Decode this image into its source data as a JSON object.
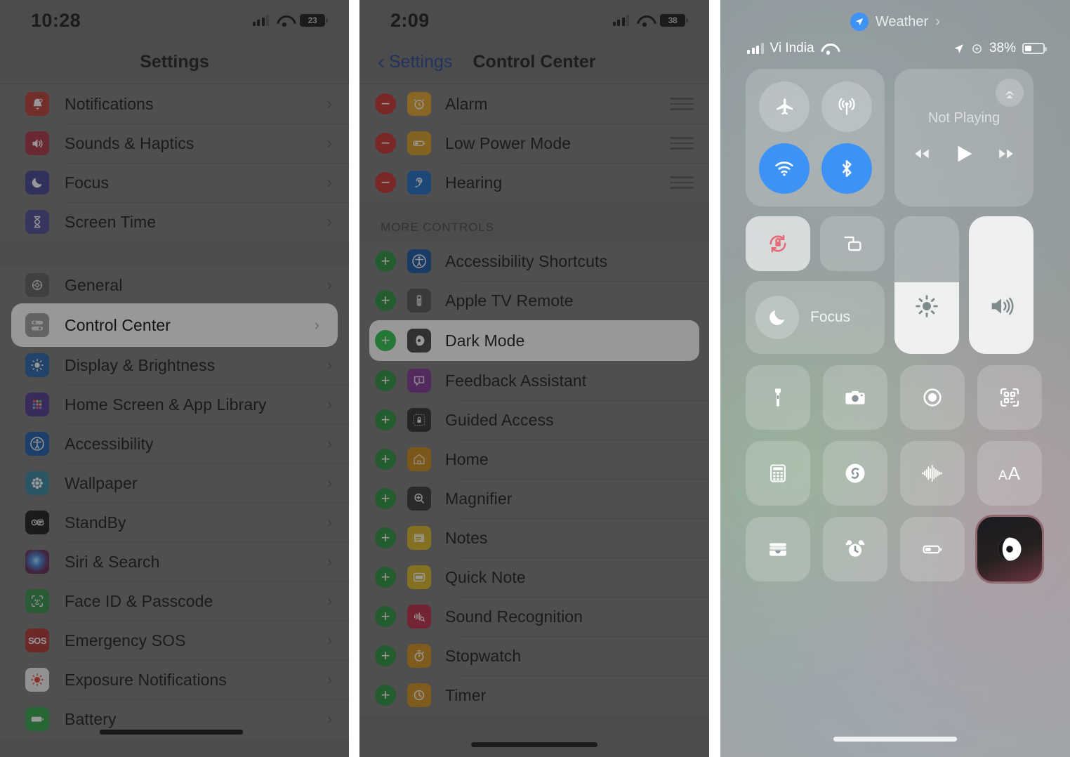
{
  "panel1": {
    "status": {
      "time": "10:28",
      "battery": "23"
    },
    "nav_title": "Settings",
    "groups": [
      {
        "items": [
          {
            "label": "Notifications",
            "icon": "bell-icon",
            "color": "#b7352c"
          },
          {
            "label": "Sounds & Haptics",
            "icon": "speaker-icon",
            "color": "#a82a3c"
          },
          {
            "label": "Focus",
            "icon": "moon-icon",
            "color": "#3b3a8f"
          },
          {
            "label": "Screen Time",
            "icon": "hourglass-icon",
            "color": "#434393"
          }
        ]
      },
      {
        "items": [
          {
            "label": "General",
            "icon": "gear-icon",
            "color": "#575757"
          },
          {
            "label": "Control Center",
            "icon": "sliders-icon",
            "color": "#6e6e6e",
            "highlighted": true
          },
          {
            "label": "Display & Brightness",
            "icon": "brightness-icon",
            "color": "#1f5fa8"
          },
          {
            "label": "Home Screen & App Library",
            "icon": "apps-grid-icon",
            "color": "#4a2f8a"
          },
          {
            "label": "Accessibility",
            "icon": "accessibility-icon",
            "color": "#1257a5"
          },
          {
            "label": "Wallpaper",
            "icon": "flower-icon",
            "color": "#2d7f9e"
          },
          {
            "label": "StandBy",
            "icon": "standby-icon",
            "color": "#101010"
          },
          {
            "label": "Siri & Search",
            "icon": "siri-icon",
            "color": "#2b1e3d"
          },
          {
            "label": "Face ID & Passcode",
            "icon": "face-id-icon",
            "color": "#2a8a43"
          },
          {
            "label": "Emergency SOS",
            "icon": "sos-icon",
            "color": "#ab2b27"
          },
          {
            "label": "Exposure Notifications",
            "icon": "exposure-icon",
            "color": "#f0f0f0"
          },
          {
            "label": "Battery",
            "icon": "battery-icon",
            "color": "#29a042"
          }
        ]
      }
    ]
  },
  "panel2": {
    "status": {
      "time": "2:09",
      "battery": "38"
    },
    "nav_back": "Settings",
    "nav_title": "Control Center",
    "included": [
      {
        "label": "Alarm",
        "icon": "alarm-clock-icon",
        "color": "#e2a020",
        "action": "remove"
      },
      {
        "label": "Low Power Mode",
        "icon": "low-battery-icon",
        "color": "#d79a18",
        "action": "remove"
      },
      {
        "label": "Hearing",
        "icon": "ear-icon",
        "color": "#1565c0",
        "action": "remove"
      }
    ],
    "more_controls_header": "MORE CONTROLS",
    "more_controls": [
      {
        "label": "Accessibility Shortcuts",
        "icon": "accessibility-icon",
        "color": "#0b4f9e",
        "action": "add"
      },
      {
        "label": "Apple TV Remote",
        "icon": "remote-icon",
        "color": "#4c4c4c",
        "action": "add"
      },
      {
        "label": "Dark Mode",
        "icon": "dark-mode-icon",
        "color": "#3a3a3a",
        "action": "add",
        "highlighted": true
      },
      {
        "label": "Feedback Assistant",
        "icon": "feedback-icon",
        "color": "#7b2d8e",
        "action": "add"
      },
      {
        "label": "Guided Access",
        "icon": "lock-frame-icon",
        "color": "#232323",
        "action": "add"
      },
      {
        "label": "Home",
        "icon": "house-icon",
        "color": "#c8820f",
        "action": "add"
      },
      {
        "label": "Magnifier",
        "icon": "magnifier-icon",
        "color": "#2c2c2c",
        "action": "add"
      },
      {
        "label": "Notes",
        "icon": "notes-icon",
        "color": "#d6b31a",
        "action": "add"
      },
      {
        "label": "Quick Note",
        "icon": "quick-note-icon",
        "color": "#d6b31a",
        "action": "add"
      },
      {
        "label": "Sound Recognition",
        "icon": "sound-wave-icon",
        "color": "#b8203c",
        "action": "add"
      },
      {
        "label": "Stopwatch",
        "icon": "stopwatch-icon",
        "color": "#d08a16",
        "action": "add"
      },
      {
        "label": "Timer",
        "icon": "timer-icon",
        "color": "#d08a16",
        "action": "add"
      }
    ]
  },
  "panel3": {
    "weather_label": "Weather",
    "carrier": "Vi India",
    "battery_pct": "38%",
    "media": {
      "title": "Not Playing"
    },
    "focus_label": "Focus",
    "connectivity": [
      {
        "name": "airplane-mode-icon",
        "on": false
      },
      {
        "name": "cellular-data-icon",
        "on": false
      },
      {
        "name": "wifi-icon",
        "on": true
      },
      {
        "name": "bluetooth-icon",
        "on": true
      }
    ],
    "tiles_row3": [
      "flashlight-icon",
      "camera-icon",
      "screen-record-icon",
      "qr-scanner-icon"
    ],
    "tiles_row4": [
      "calculator-icon",
      "shazam-icon",
      "sound-recognition-icon",
      "text-size-icon"
    ],
    "tiles_row5": [
      "wallet-icon",
      "alarm-icon",
      "low-power-icon",
      "dark-mode-icon"
    ],
    "highlighted_tile": "dark-mode-icon"
  }
}
